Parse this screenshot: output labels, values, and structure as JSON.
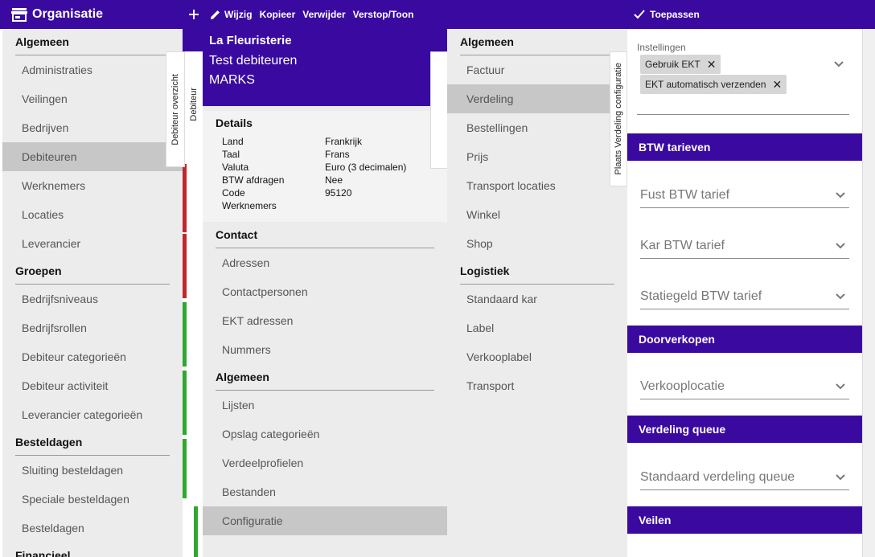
{
  "topbar": {
    "app_title": "Organisatie",
    "actions": [
      "Wijzig",
      "Kopieer",
      "Verwijder",
      "Verstop/Toon"
    ],
    "apply_label": "Toepassen"
  },
  "nav": {
    "sections": [
      {
        "title": "Algemeen",
        "items": [
          "Administraties",
          "Veilingen",
          "Bedrijven",
          "Debiteuren",
          "Werknemers",
          "Locaties",
          "Leverancier"
        ]
      },
      {
        "title": "Groepen",
        "items": [
          "Bedrijfsniveaus",
          "Bedrijfsrollen",
          "Debiteur categorieën",
          "Debiteur activiteit",
          "Leverancier categorieën"
        ]
      },
      {
        "title": "Besteldagen",
        "items": [
          "Sluiting besteldagen",
          "Speciale besteldagen",
          "Besteldagen"
        ]
      },
      {
        "title": "Financieel",
        "items": []
      }
    ],
    "active": "Debiteuren"
  },
  "list_tabs": {
    "overview": "Debiteur overzicht",
    "debiteur": "Debiteur"
  },
  "detail": {
    "name": "La Fleuristerie",
    "subtitle": "Test debiteuren",
    "code_line": "MARKS",
    "details_title": "Details",
    "fields": [
      {
        "k": "Land",
        "v": "Frankrijk"
      },
      {
        "k": "Taal",
        "v": "Frans"
      },
      {
        "k": "Valuta",
        "v": "Euro (3 decimalen)"
      },
      {
        "k": "BTW afdragen",
        "v": "Nee"
      },
      {
        "k": "Code",
        "v": "95120"
      },
      {
        "k": "Werknemers",
        "v": ""
      }
    ],
    "contact_title": "Contact",
    "contact_items": [
      "Adressen",
      "Contactpersonen",
      "EKT adressen",
      "Nummers"
    ],
    "algemeen_title": "Algemeen",
    "algemeen_items": [
      "Lijsten",
      "Opslag categorieën",
      "Verdeelprofielen",
      "Bestanden",
      "Configuratie"
    ],
    "active": "Configuratie"
  },
  "config_nav": {
    "sections": [
      {
        "title": "Algemeen",
        "items": [
          "Factuur",
          "Verdeling",
          "Bestellingen",
          "Prijs",
          "Transport locaties",
          "Winkel",
          "Shop"
        ]
      },
      {
        "title": "Logistiek",
        "items": [
          "Standaard kar",
          "Label",
          "Verkooplabel",
          "Transport"
        ]
      }
    ],
    "active": "Verdeling",
    "side_tab": "Plaats Verdeling configuratie"
  },
  "form": {
    "settings_label": "Instellingen",
    "chips": [
      "Gebruik EKT",
      "EKT automatisch verzenden"
    ],
    "sections": {
      "btw": "BTW tarieven",
      "doorverkopen": "Doorverkopen",
      "queue": "Verdeling queue",
      "veilen": "Veilen"
    },
    "fields": {
      "fust_btw": "Fust BTW tarief",
      "kar_btw": "Kar BTW tarief",
      "statiegeld_btw": "Statiegeld BTW tarief",
      "verkooplocatie": "Verkooplocatie",
      "standaard_queue": "Standaard verdeling queue"
    }
  },
  "colors": {
    "brand": "#3a0aa0",
    "panel": "#ececec",
    "active": "#c7c7c7",
    "status_green": "#2fa82f",
    "status_red": "#c0272d"
  }
}
